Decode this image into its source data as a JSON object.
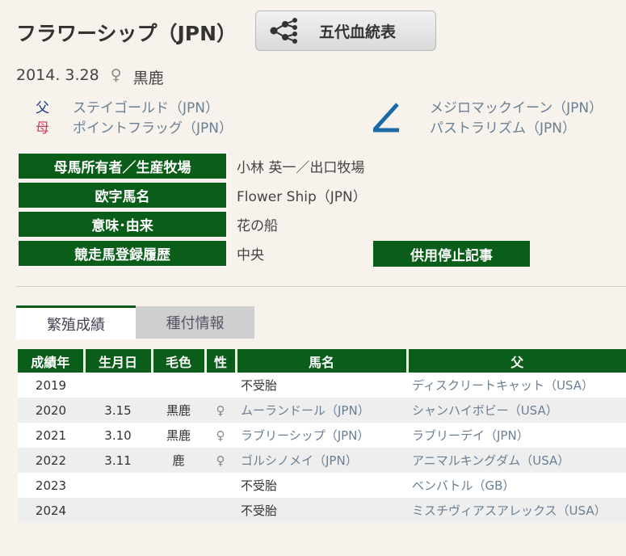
{
  "horse": {
    "name": "フラワーシップ（JPN）",
    "birth_date": "2014. 3.28",
    "sex": "♀",
    "color": "黒鹿"
  },
  "pedigree_button": {
    "label": "五代血統表"
  },
  "parents": {
    "sire_rel": "父",
    "sire": "ステイゴールド（JPN）",
    "dam_rel": "母",
    "dam": "ポイントフラッグ（JPN）",
    "damsire": "メジロマックイーン（JPN）",
    "damdam": "パストラリズム（JPN）"
  },
  "info": {
    "owner_label": "母馬所有者／生産牧場",
    "owner_value": "小林 英一／出口牧場",
    "roman_label": "欧字馬名",
    "roman_value": "Flower Ship（JPN）",
    "meaning_label": "意味･由来",
    "meaning_value": "花の船",
    "race_label": "競走馬登録履歴",
    "race_value": "中央",
    "stop_button": "供用停止記事"
  },
  "tabs": [
    {
      "label": "繁殖成績"
    },
    {
      "label": "種付情報"
    }
  ],
  "table": {
    "headers": [
      "成績年",
      "生月日",
      "毛色",
      "性",
      "馬名",
      "父"
    ],
    "rows": [
      {
        "year": "2019",
        "date": "",
        "color": "",
        "sex": "",
        "name": "不受胎",
        "sire": "ディスクリートキャット（USA）"
      },
      {
        "year": "2020",
        "date": "3.15",
        "color": "黒鹿",
        "sex": "♀",
        "name": "ムーランドール（JPN）",
        "sire": "シャンハイボビー（USA）"
      },
      {
        "year": "2021",
        "date": "3.10",
        "color": "黒鹿",
        "sex": "♀",
        "name": "ラブリーシップ（JPN）",
        "sire": "ラブリーデイ（JPN）"
      },
      {
        "year": "2022",
        "date": "3.11",
        "color": "鹿",
        "sex": "♀",
        "name": "ゴルシノメイ（JPN）",
        "sire": "アニマルキングダム（USA）"
      },
      {
        "year": "2023",
        "date": "",
        "color": "",
        "sex": "",
        "name": "不受胎",
        "sire": "ベンバトル（GB）"
      },
      {
        "year": "2024",
        "date": "",
        "color": "",
        "sex": "",
        "name": "不受胎",
        "sire": "ミスチヴィアスアレックス（USA）"
      }
    ]
  }
}
